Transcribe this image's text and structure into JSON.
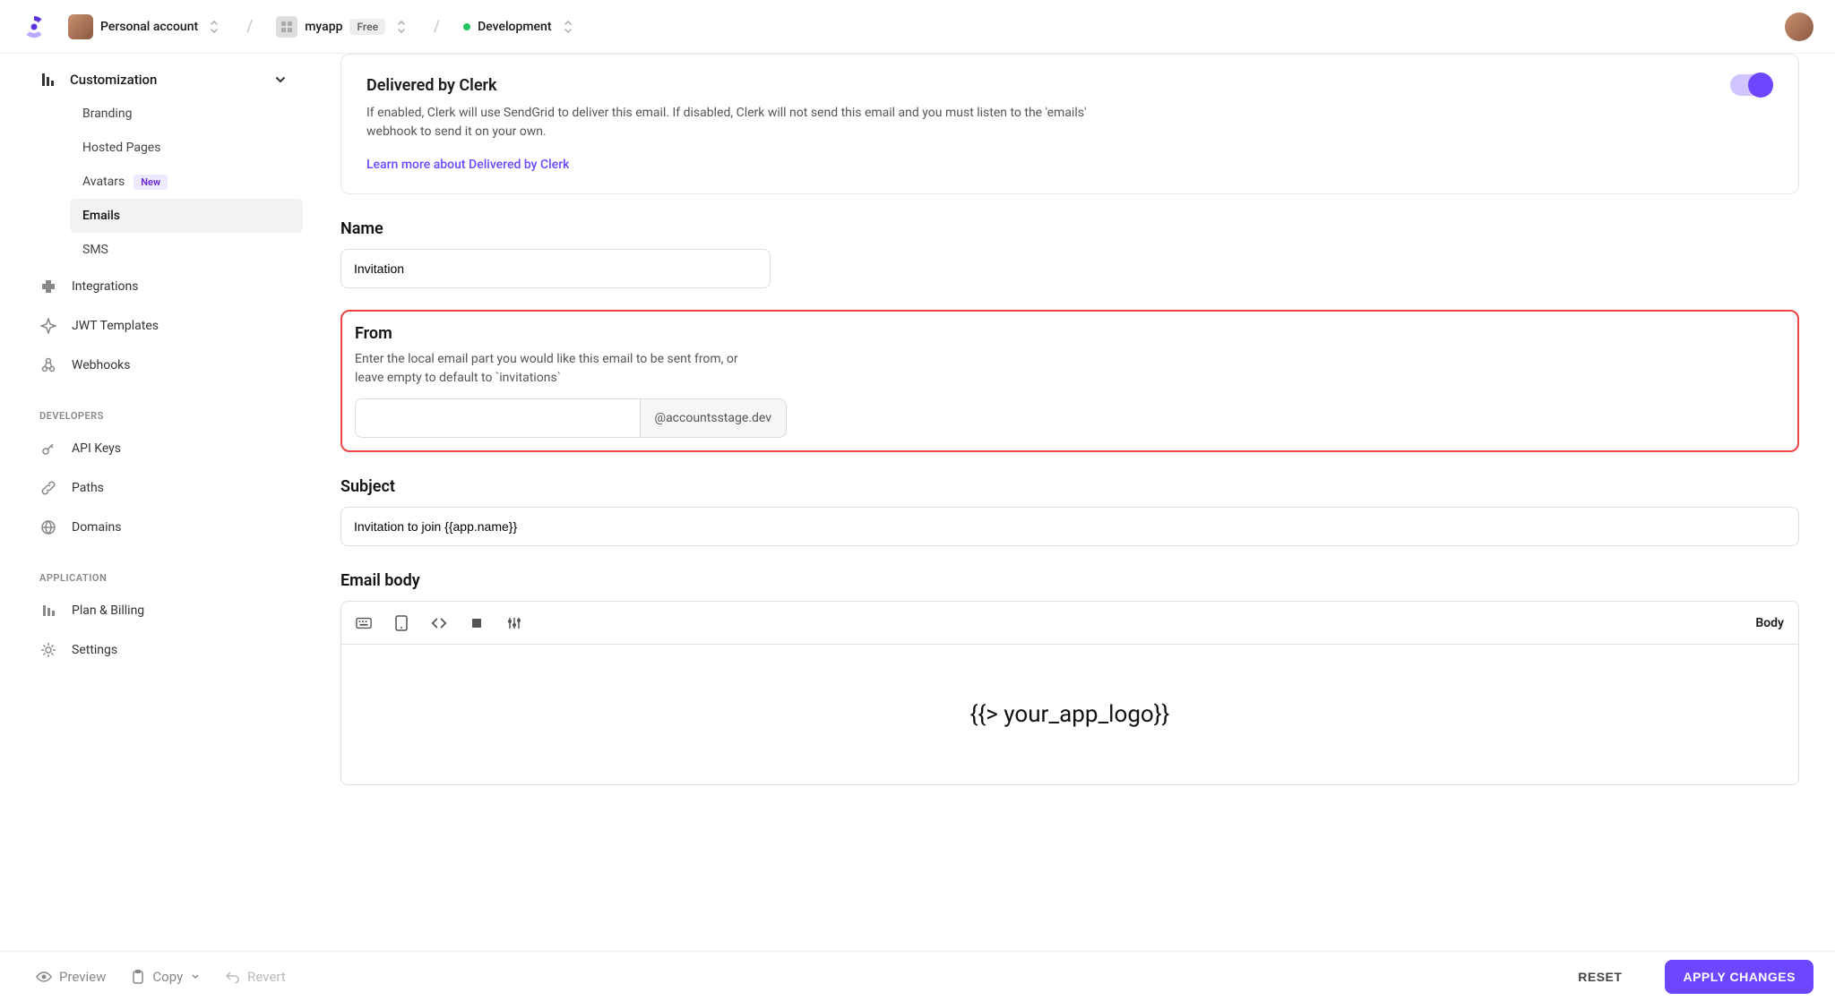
{
  "header": {
    "account_label": "Personal account",
    "app_name": "myapp",
    "app_plan": "Free",
    "environment": "Development"
  },
  "sidebar": {
    "customization_label": "Customization",
    "sub": {
      "branding": "Branding",
      "hosted_pages": "Hosted Pages",
      "avatars": "Avatars",
      "avatars_badge": "New",
      "emails": "Emails",
      "sms": "SMS"
    },
    "integrations": "Integrations",
    "jwt_templates": "JWT Templates",
    "webhooks": "Webhooks",
    "section_dev": "DEVELOPERS",
    "api_keys": "API Keys",
    "paths": "Paths",
    "domains": "Domains",
    "section_app": "APPLICATION",
    "plan_billing": "Plan & Billing",
    "settings": "Settings"
  },
  "card": {
    "title": "Delivered by Clerk",
    "description": "If enabled, Clerk will use SendGrid to deliver this email. If disabled, Clerk will not send this email and you must listen to the 'emails' webhook to send it on your own.",
    "link": "Learn more about Delivered by Clerk"
  },
  "fields": {
    "name_label": "Name",
    "name_value": "Invitation",
    "from_label": "From",
    "from_help": "Enter the local email part you would like this email to be sent from, or leave empty to default to `invitations`",
    "from_value": "",
    "from_domain": "@accountsstage.dev",
    "subject_label": "Subject",
    "subject_value": "Invitation to join {{app.name}}",
    "body_label": "Email body"
  },
  "editor": {
    "toolbar_body": "Body",
    "content": "{{> your_app_logo}}"
  },
  "footer": {
    "preview": "Preview",
    "copy": "Copy",
    "revert": "Revert",
    "reset": "RESET",
    "apply": "APPLY CHANGES"
  }
}
